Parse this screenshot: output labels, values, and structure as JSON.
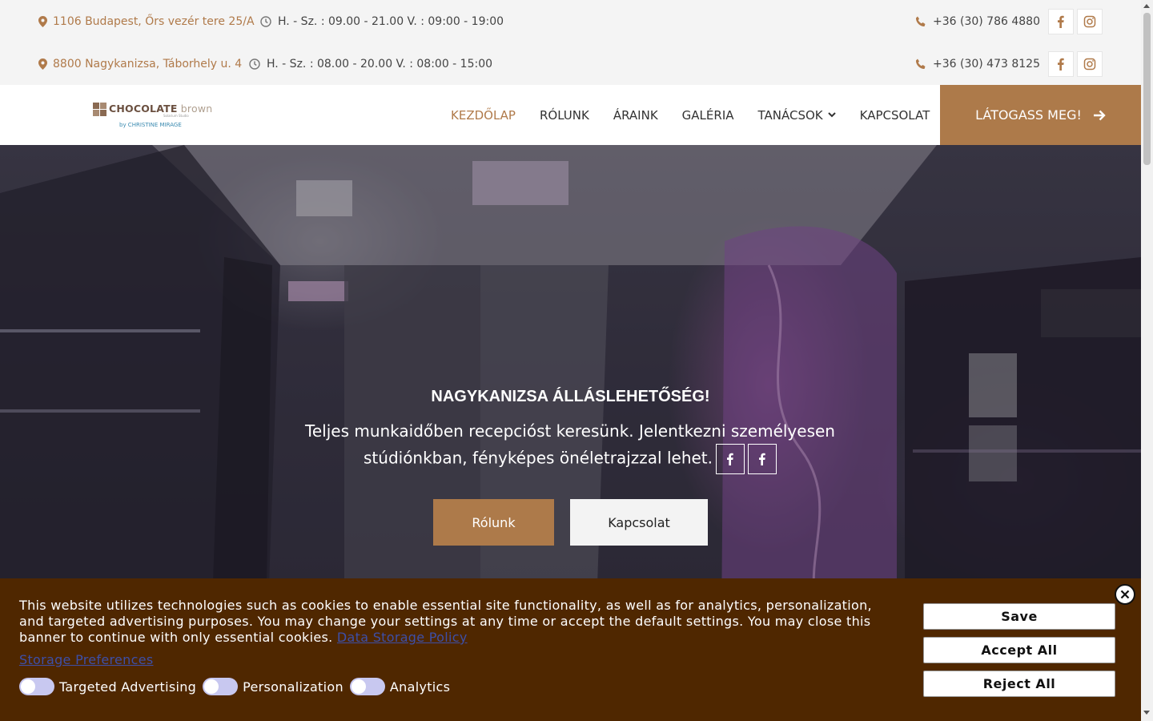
{
  "topbar": {
    "rows": [
      {
        "address": "1106 Budapest, Őrs vezér tere 25/A",
        "hours": "H. - Sz. : 09.00 - 21.00 V. : 09:00 - 19:00",
        "phone": "+36 (30) 786 4880"
      },
      {
        "address": "8800 Nagykanizsa, Táborhely u. 4",
        "hours": "H. - Sz. : 08.00 - 20.00 V. : 08:00 - 15:00",
        "phone": "+36 (30) 473 8125"
      }
    ]
  },
  "logo": {
    "brand_bold": "CHOCOLATE",
    "brand_light": " brown",
    "tagline": "Solarium Studio",
    "by": "by CHRISTINE MIRAGE"
  },
  "nav": {
    "items": [
      "KEZDŐLAP",
      "RÓLUNK",
      "ÁRAINK",
      "GALÉRIA",
      "TANÁCSOK",
      "KAPCSOLAT"
    ],
    "cta": "LÁTOGASS MEG!"
  },
  "hero": {
    "title": "NAGYKANIZSA ÁLLÁSLEHETŐSÉG!",
    "text": "Teljes munkaidőben recepcióst keresünk. Jelentkezni személyesen stúdiónkban, fényképes önéletrajzzal lehet.",
    "button_primary": "Rólunk",
    "button_secondary": "Kapcsolat"
  },
  "cookie": {
    "text": "This website utilizes technologies such as cookies to enable essential site functionality, as well as for analytics, personalization, and targeted advertising purposes. You may change your settings at any time or accept the default settings. You may close this banner to continue with only essential cookies.",
    "policy_link": "Data Storage Policy",
    "preferences_link": "Storage Preferences",
    "toggles": [
      "Targeted Advertising",
      "Personalization",
      "Analytics"
    ],
    "save": "Save",
    "accept": "Accept All",
    "reject": "Reject All"
  },
  "colors": {
    "accent": "#ad7a4a",
    "banner": "#4f2700",
    "link": "#3d4fa8"
  }
}
